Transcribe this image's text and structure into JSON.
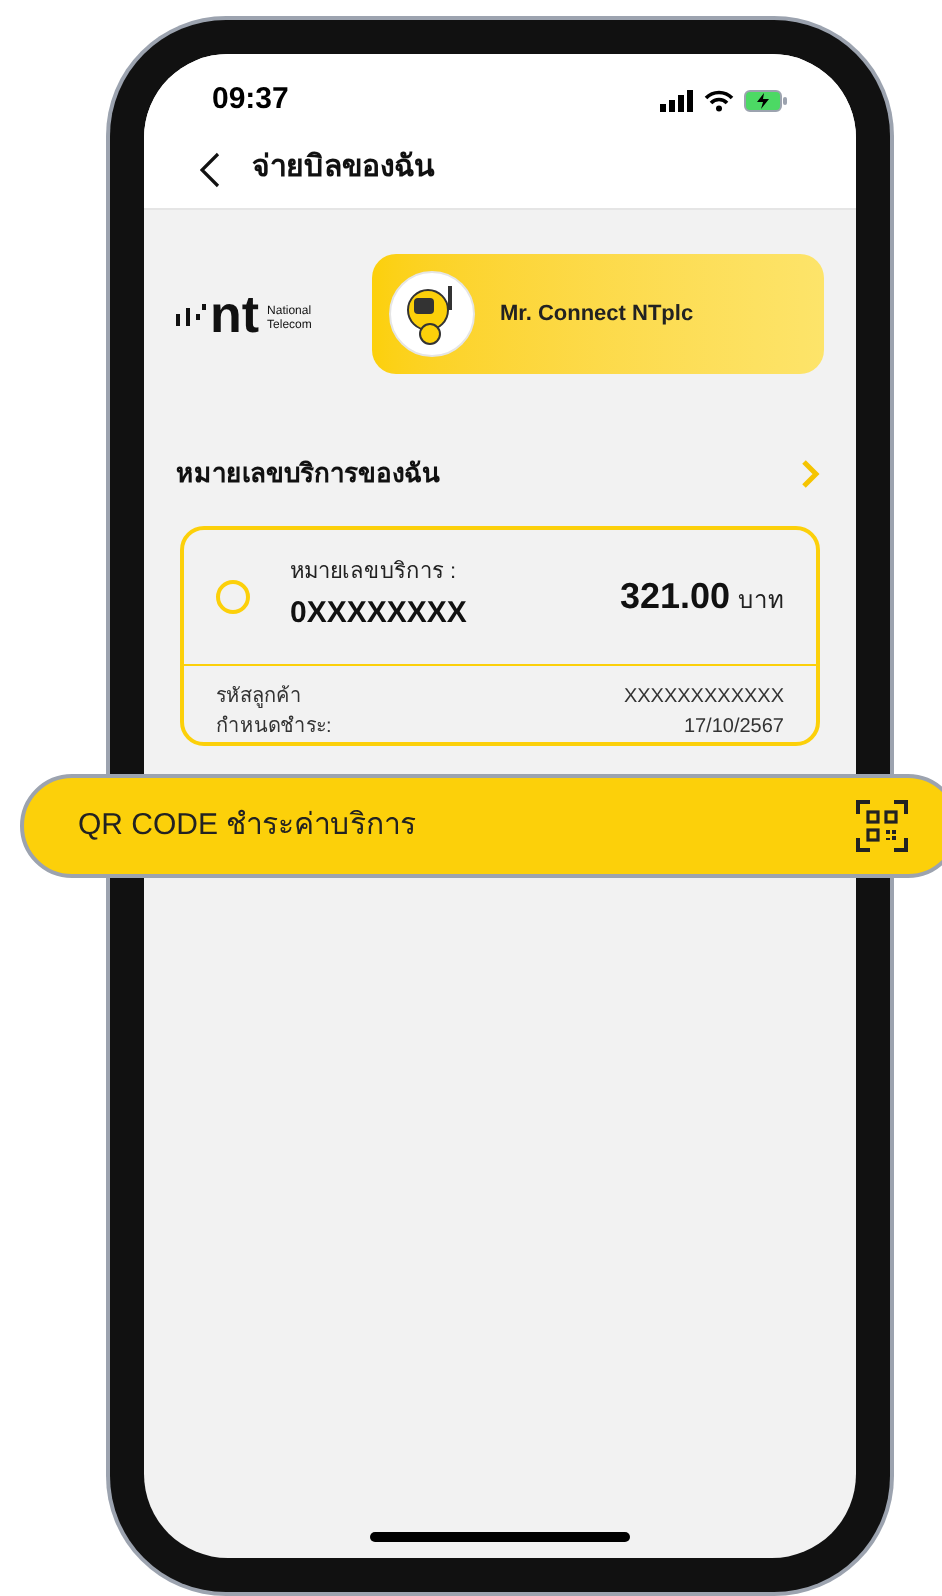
{
  "status_bar": {
    "time": "09:37"
  },
  "header": {
    "title": "จ่ายบิลของฉัน"
  },
  "brand": {
    "logo_text": "nt",
    "logo_subtitle": [
      "National",
      "Telecom"
    ]
  },
  "promo_card": {
    "label": "Mr. Connect NTplc"
  },
  "section": {
    "title": "หมายเลขบริการของฉัน"
  },
  "bills": [
    {
      "selected": false,
      "number_label": "หมายเลขบริการ :",
      "number": "0XXXXXXXX",
      "amount": "321.00",
      "currency": "บาท",
      "details": [
        {
          "label": "รหัสลูกค้า",
          "value": "XXXXXXXXXXXX"
        },
        {
          "label": "กำหนดชำระ:",
          "value": "17/10/2567"
        }
      ]
    }
  ],
  "qr_button": {
    "label": "QR CODE ชำระค่าบริการ"
  }
}
